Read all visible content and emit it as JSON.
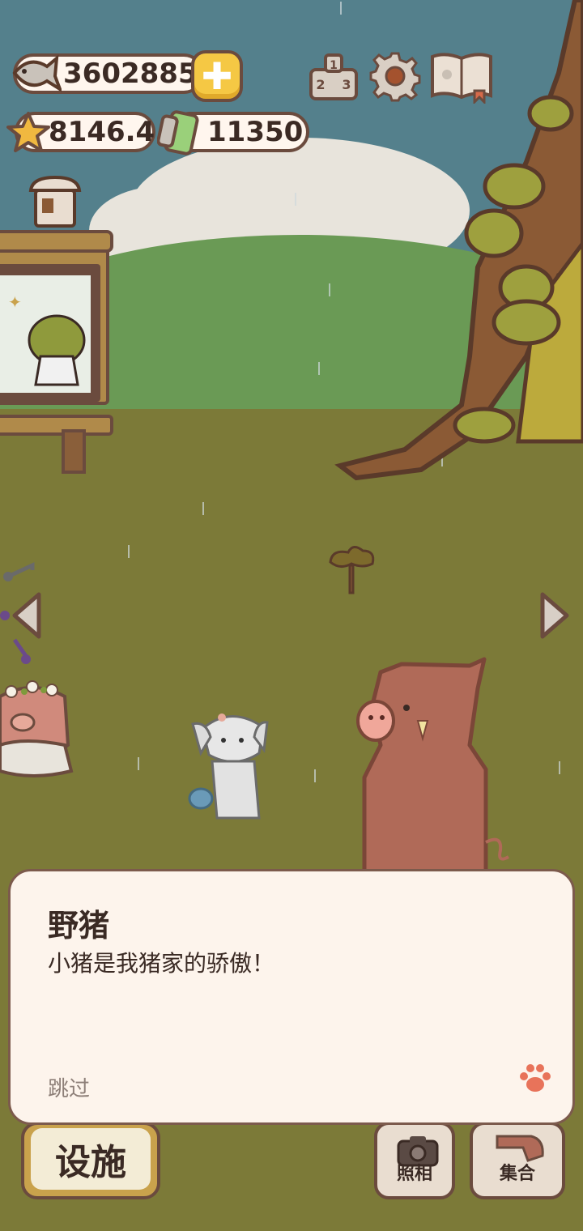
{
  "hud": {
    "fish_count": "3602885",
    "star_count": "8146.4",
    "battery_count": "11350",
    "icons": [
      "fish-icon",
      "plus-icon",
      "star-icon",
      "battery-icon",
      "ranking-icon",
      "gear-icon",
      "book-icon"
    ]
  },
  "dialog": {
    "speaker": "野猪",
    "text": "小猪是我猪家的骄傲！",
    "skip_label": "跳过"
  },
  "bottom_bar": {
    "facility_label": "设施",
    "camera_label": "照相",
    "gather_label": "集合"
  },
  "colors": {
    "outline": "#6b4b3e",
    "dialog_bg": "#fdf4ec",
    "plus_yellow": "#f5c844",
    "boar": "#b06a58",
    "grass": "#7c7a38"
  }
}
